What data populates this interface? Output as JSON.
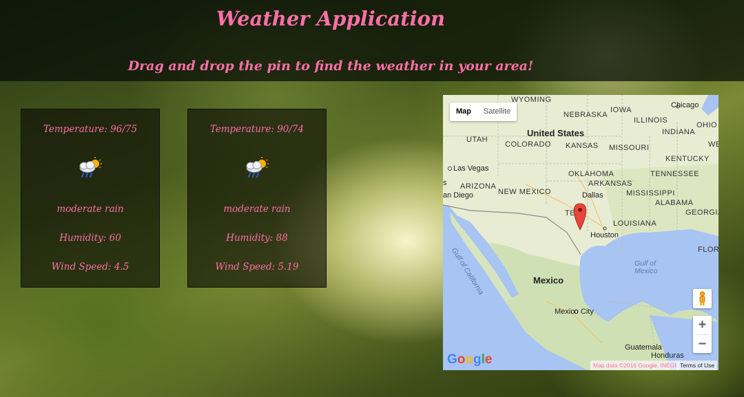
{
  "header": {
    "title": "Weather Application",
    "subtitle": "Drag and drop the pin to find the weather in your area!"
  },
  "forecasts": [
    {
      "temperature": "Temperature: 96/75",
      "icon": "rain-sun-icon",
      "description": "moderate rain",
      "humidity": "Humidity: 60",
      "wind": "Wind Speed: 4.5"
    },
    {
      "temperature": "Temperature: 90/74",
      "icon": "rain-sun-icon",
      "description": "moderate rain",
      "humidity": "Humidity: 88",
      "wind": "Wind Speed: 5.19"
    }
  ],
  "map": {
    "type_map": "Map",
    "type_satellite": "Satellite",
    "zoom_in": "+",
    "zoom_out": "−",
    "attribution": "Map data ©2016 Google, INEGI",
    "terms": "Terms of Use",
    "logo": "Google",
    "labels": {
      "wyoming": "WYOMING",
      "nebraska": "NEBRASKA",
      "iowa": "IOWA",
      "chicago": "Chicago",
      "illinois": "ILLINOIS",
      "ohio": "OHIO",
      "united_states": "United States",
      "utah": "UTAH",
      "colorado": "COLORADO",
      "kansas": "KANSAS",
      "missouri": "MISSOURI",
      "indiana": "INDIANA",
      "we": "WE",
      "kentucky": "KENTUCKY",
      "las_vegas": "Las Vegas",
      "oklahoma": "OKLAHOMA",
      "tennessee": "TENNESSEE",
      "s": "s",
      "arizona": "ARIZONA",
      "new_mexico": "NEW MEXICO",
      "arkansas": "ARKANSAS",
      "an_diego": "an Diego",
      "dallas": "Dallas",
      "mississippi": "MISSISSIPPI",
      "alabama": "ALABAMA",
      "georgia": "GEORGIA",
      "te": "TE",
      "louisiana": "LOUISIANA",
      "houston": "Houston",
      "flor": "FLOR",
      "gulf_california": "Gulf of California",
      "gulf_mexico": "Gulf of Mexico",
      "mexico": "Mexico",
      "mexico_city": "Mexico City",
      "guatemala": "Guatemala",
      "honduras": "Honduras"
    }
  },
  "colors": {
    "accent": "#ff6fa8",
    "water": "#a7c4f2",
    "land": "#e8ecd2"
  }
}
